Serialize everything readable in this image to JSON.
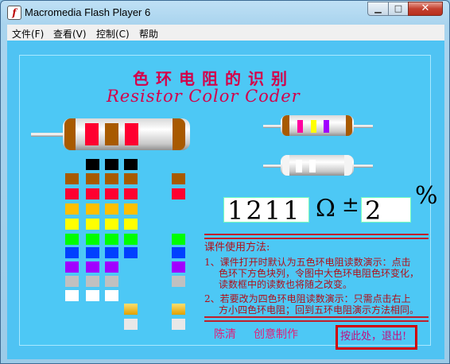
{
  "window": {
    "title": "Macromedia Flash Player 6",
    "icon": "f-icon",
    "min": "▁",
    "max": "□",
    "close": "✕"
  },
  "menu": [
    "文件(F)",
    "查看(V)",
    "控制(C)",
    "帮助"
  ],
  "app": {
    "title_cn": "色环电阻的识别",
    "title_en": "Resistor Color Coder",
    "value": "1211",
    "ohm": "Ω",
    "pm": "±",
    "tolerance": "2",
    "percent": "%",
    "instructions": {
      "heading": "课件使用方法:",
      "item1": [
        "1、课件打开时默认为五色环电阻读数演示：点击",
        "色环下方色块列，令图中大色环电阻色环变化，",
        "读数框中的读数也将随之改变。"
      ],
      "item2": [
        "2、若要改为四色环电阻读数演示：只需点击右上",
        "方小四色环电阻；回到五环电阻演示方法相同。"
      ]
    },
    "author": "陈清",
    "credit": "创意制作",
    "exit": "按此处，退出!"
  },
  "colors": {
    "background": "#4dc8f5",
    "brown": "#a85a00",
    "red": "#ff0030",
    "orange": "#ff8c00",
    "yellow": "#ffff00",
    "green": "#00ff00",
    "blue": "#0040ff",
    "violet": "#a000ff",
    "gray": "#c0c0c0",
    "white": "#ffffff",
    "black": "#000000",
    "gold": "#ffc000",
    "silver": "#e8e8e8"
  }
}
